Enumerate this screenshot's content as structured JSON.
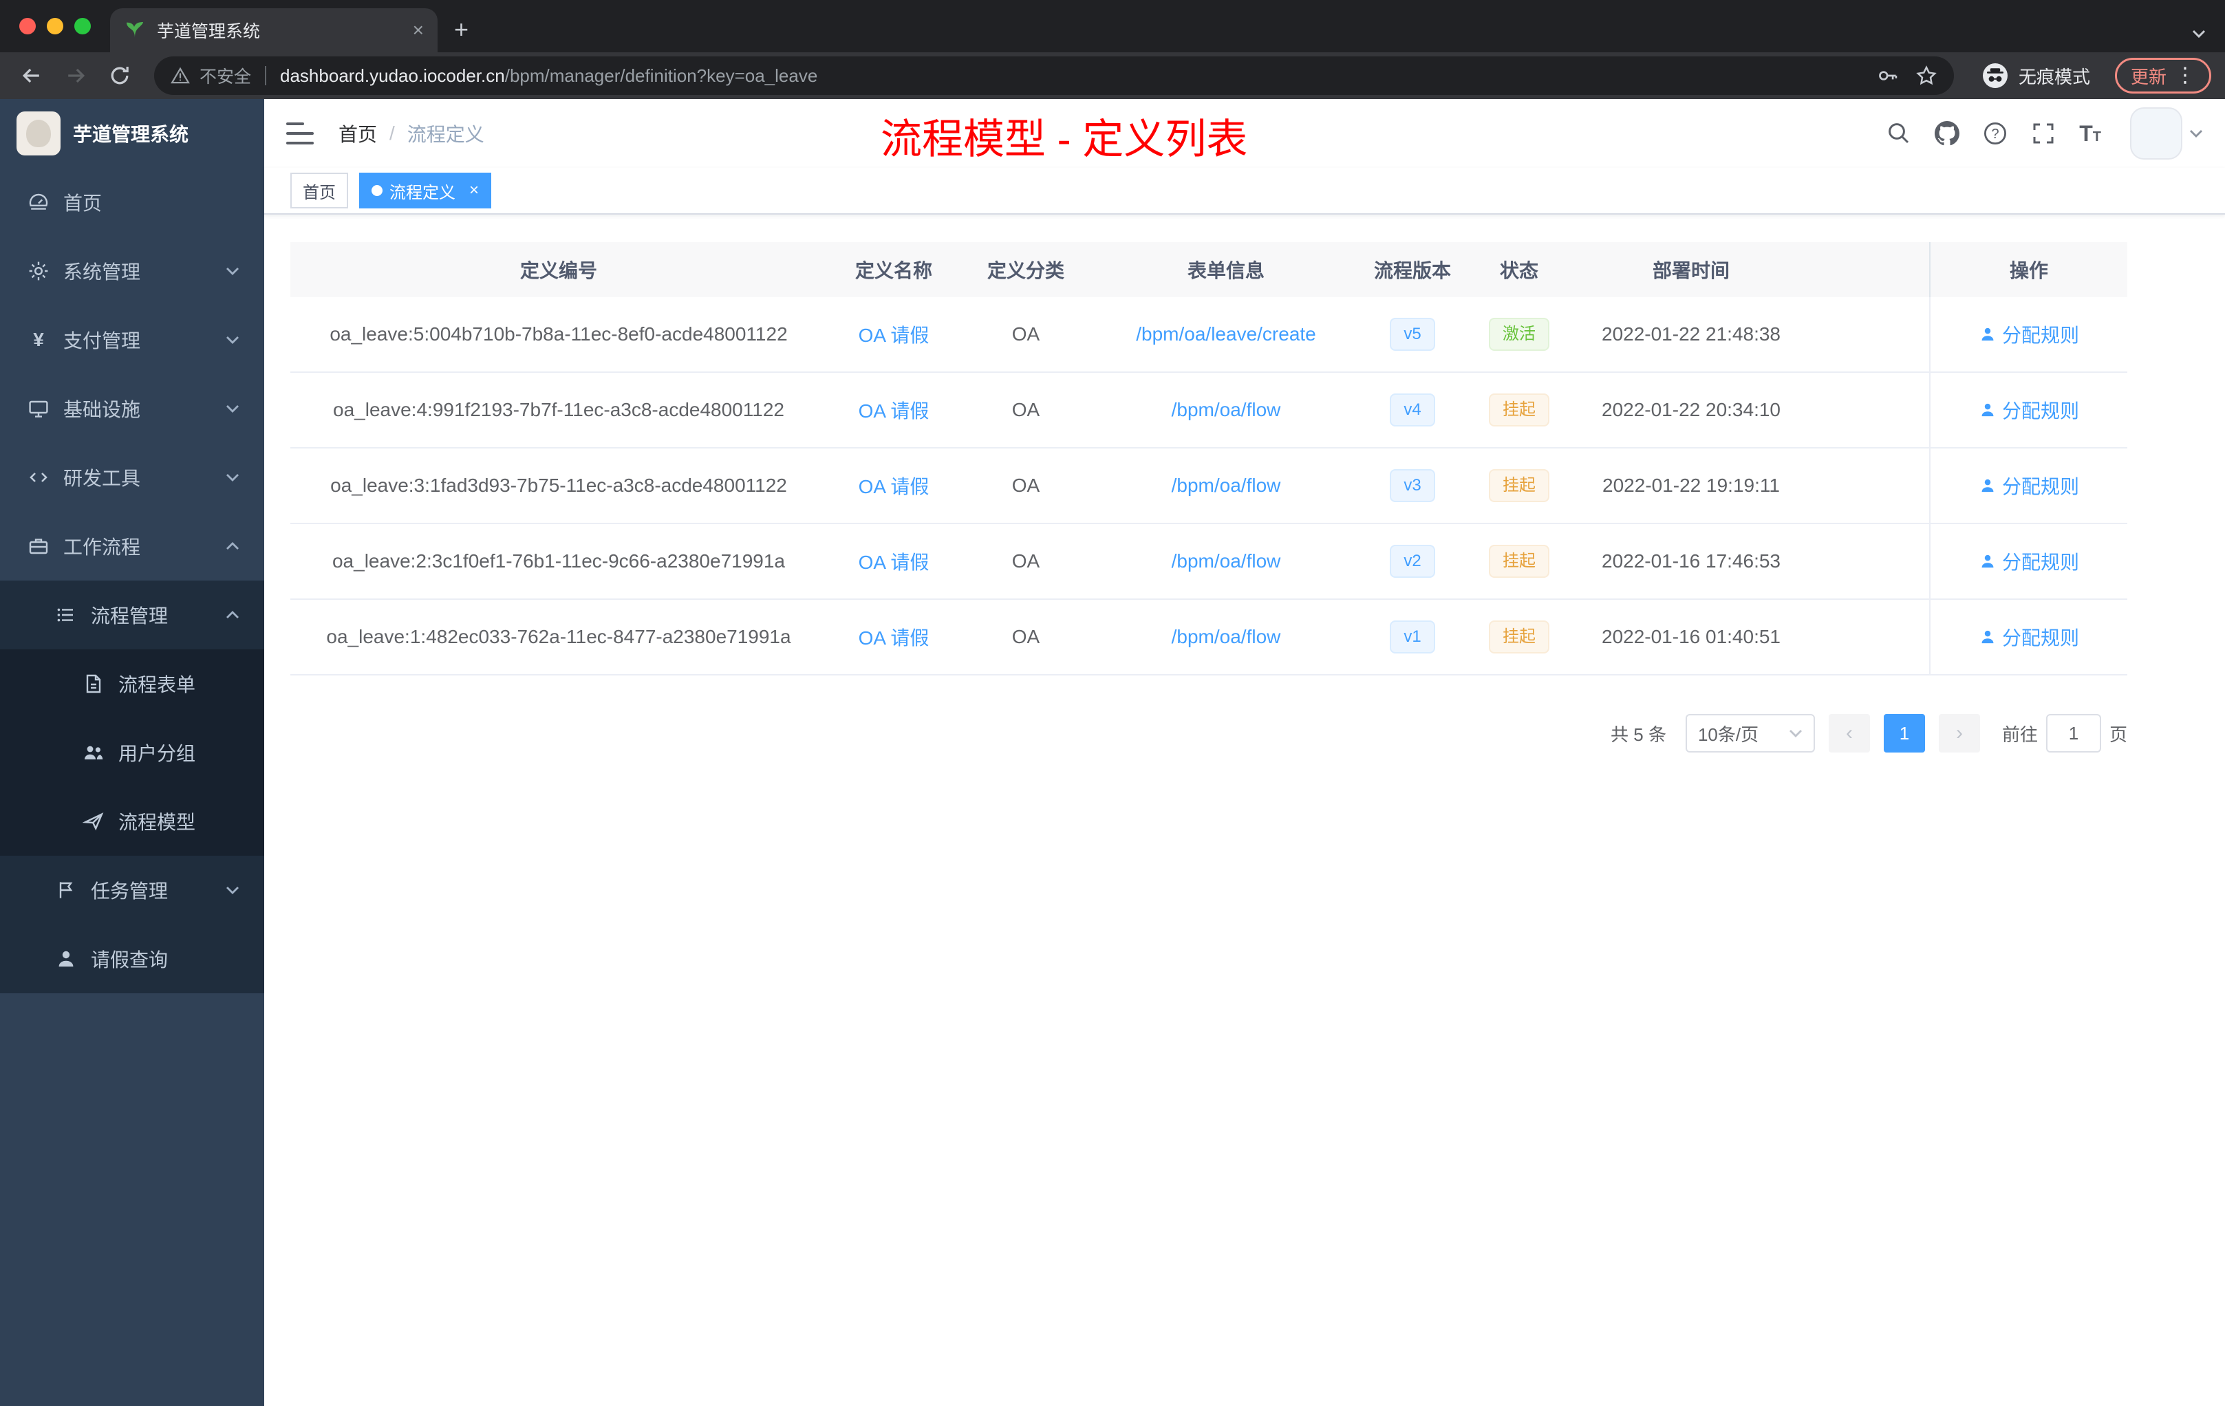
{
  "colors": {
    "accent": "#409EFF",
    "success": "#67C23A",
    "warning": "#E6A23C",
    "sidebar_bg": "#304156",
    "annotation_red": "#FF0000"
  },
  "browser": {
    "tab_title": "芋道管理系统",
    "security_label": "不安全",
    "url_domain": "dashboard.yudao.iocoder.cn",
    "url_path": "/bpm/manager/definition?key=oa_leave",
    "incognito_label": "无痕模式",
    "update_label": "更新"
  },
  "sidebar": {
    "logo_title": "芋道管理系统",
    "items": [
      {
        "label": "首页"
      },
      {
        "label": "系统管理"
      },
      {
        "label": "支付管理"
      },
      {
        "label": "基础设施"
      },
      {
        "label": "研发工具"
      },
      {
        "label": "工作流程"
      },
      {
        "label": "流程管理"
      },
      {
        "label": "流程表单"
      },
      {
        "label": "用户分组"
      },
      {
        "label": "流程模型"
      },
      {
        "label": "任务管理"
      },
      {
        "label": "请假查询"
      }
    ]
  },
  "header": {
    "breadcrumb_home": "首页",
    "breadcrumb_separator": "/",
    "breadcrumb_current": "流程定义",
    "annotation": "流程模型 - 定义列表"
  },
  "tags": {
    "home": "首页",
    "active": "流程定义"
  },
  "table": {
    "columns": [
      "定义编号",
      "定义名称",
      "定义分类",
      "表单信息",
      "流程版本",
      "状态",
      "部署时间",
      "操作"
    ],
    "rows": [
      {
        "id": "oa_leave:5:004b710b-7b8a-11ec-8ef0-acde48001122",
        "name": "OA 请假",
        "category": "OA",
        "form": "/bpm/oa/leave/create",
        "version": "v5",
        "status": "激活",
        "status_type": "success",
        "time": "2022-01-22 21:48:38",
        "action": "分配规则"
      },
      {
        "id": "oa_leave:4:991f2193-7b7f-11ec-a3c8-acde48001122",
        "name": "OA 请假",
        "category": "OA",
        "form": "/bpm/oa/flow",
        "version": "v4",
        "status": "挂起",
        "status_type": "warning",
        "time": "2022-01-22 20:34:10",
        "action": "分配规则"
      },
      {
        "id": "oa_leave:3:1fad3d93-7b75-11ec-a3c8-acde48001122",
        "name": "OA 请假",
        "category": "OA",
        "form": "/bpm/oa/flow",
        "version": "v3",
        "status": "挂起",
        "status_type": "warning",
        "time": "2022-01-22 19:19:11",
        "action": "分配规则"
      },
      {
        "id": "oa_leave:2:3c1f0ef1-76b1-11ec-9c66-a2380e71991a",
        "name": "OA 请假",
        "category": "OA",
        "form": "/bpm/oa/flow",
        "version": "v2",
        "status": "挂起",
        "status_type": "warning",
        "time": "2022-01-16 17:46:53",
        "action": "分配规则"
      },
      {
        "id": "oa_leave:1:482ec033-762a-11ec-8477-a2380e71991a",
        "name": "OA 请假",
        "category": "OA",
        "form": "/bpm/oa/flow",
        "version": "v1",
        "status": "挂起",
        "status_type": "warning",
        "time": "2022-01-16 01:40:51",
        "action": "分配规则"
      }
    ]
  },
  "pagination": {
    "total": "共 5 条",
    "page_size": "10条/页",
    "prev": "‹",
    "current_page": "1",
    "next": "›",
    "goto_label": "前往",
    "goto_value": "1",
    "page_unit": "页"
  }
}
